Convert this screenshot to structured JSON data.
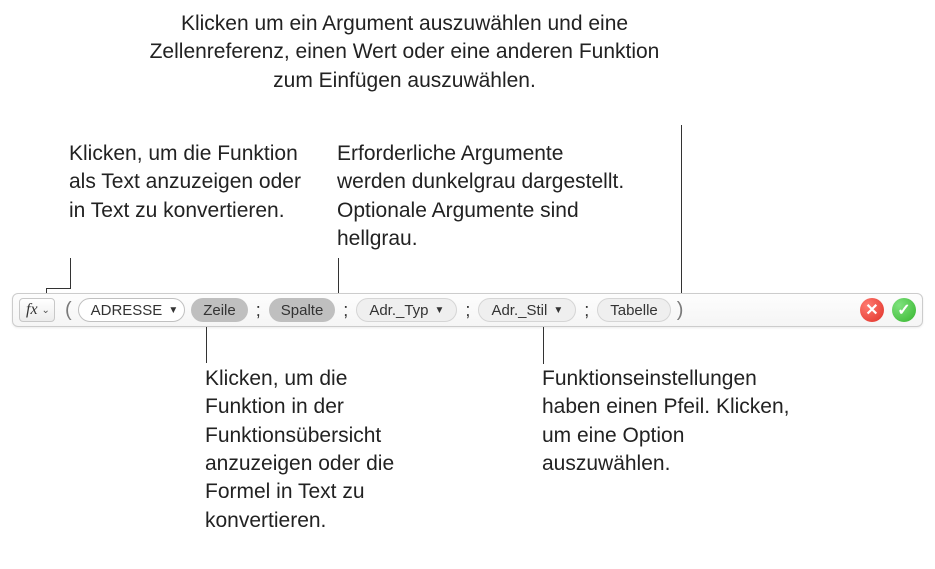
{
  "callouts": {
    "top_right": "Klicken um ein Argument auszuwählen und eine Zellenreferenz, einen Wert oder eine anderen Funktion zum Einfügen auszuwählen.",
    "top_left": "Klicken, um die Funktion als Text anzuzeigen oder in Text zu konvertieren.",
    "top_mid": "Erforderliche Argumente werden dunkelgrau dargestellt. Optionale Argumente sind hellgrau.",
    "bottom_left": "Klicken, um die Funktion in der Funktionsübersicht anzuzeigen oder die Formel in Text zu konvertieren.",
    "bottom_right": "Funktionseinstellungen haben einen Pfeil. Klicken, um eine Option auszuwählen."
  },
  "formula": {
    "function_name": "ADRESSE",
    "args": {
      "row": "Zeile",
      "col": "Spalte",
      "adr_type": "Adr._Typ",
      "adr_style": "Adr._Stil",
      "table": "Tabelle"
    },
    "separator": ";"
  },
  "icons": {
    "fx_label": "fx"
  }
}
